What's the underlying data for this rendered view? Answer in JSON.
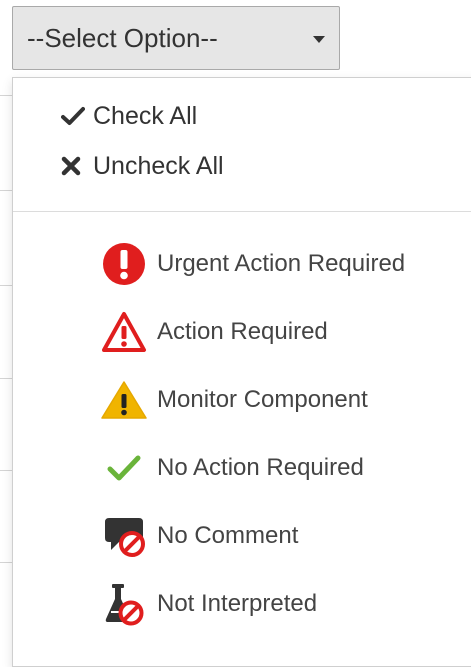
{
  "select": {
    "label": "--Select Option--",
    "caret_icon": "caret-down-icon"
  },
  "menu": {
    "check_all": {
      "label": "Check All",
      "icon": "check-icon"
    },
    "uncheck_all": {
      "label": "Uncheck All",
      "icon": "x-icon"
    },
    "options": [
      {
        "label": "Urgent Action Required",
        "icon": "urgent-exclamation-circle-icon",
        "color": "#e01e1e"
      },
      {
        "label": "Action Required",
        "icon": "warning-triangle-outline-icon",
        "color": "#e01e1e"
      },
      {
        "label": "Monitor Component",
        "icon": "warning-triangle-yellow-icon",
        "color": "#f0b400"
      },
      {
        "label": "No Action Required",
        "icon": "green-check-icon",
        "color": "#6ab43a"
      },
      {
        "label": "No Comment",
        "icon": "no-comment-icon",
        "color": "#e01e1e"
      },
      {
        "label": "Not Interpreted",
        "icon": "not-interpreted-flask-icon",
        "color": "#e01e1e"
      }
    ]
  }
}
